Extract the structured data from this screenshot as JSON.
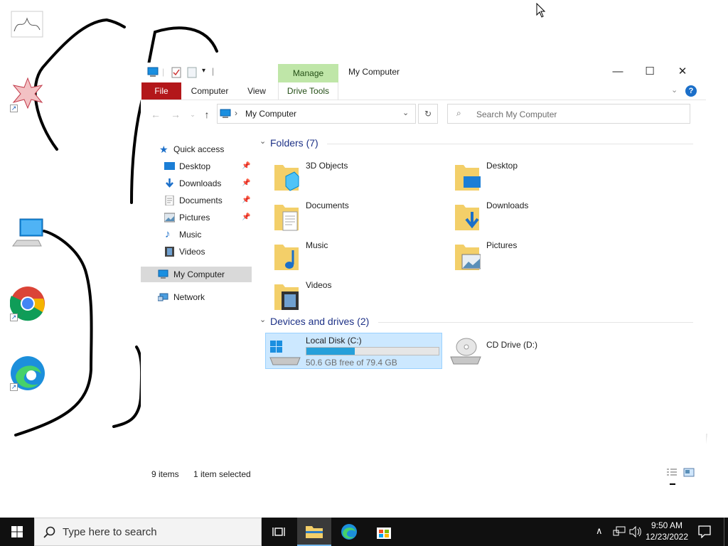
{
  "window": {
    "title": "My Computer",
    "manage_tab": "Manage",
    "drive_tools_tab": "Drive Tools",
    "tabs": [
      {
        "label": "File"
      },
      {
        "label": "Computer"
      },
      {
        "label": "View"
      }
    ],
    "controls": {
      "minimize": "—",
      "maximize": "☐",
      "close": "✕"
    },
    "help": "?"
  },
  "address": {
    "location": "My Computer"
  },
  "search": {
    "placeholder": "Search My Computer"
  },
  "nav_pane": {
    "quick_access": "Quick access",
    "items": [
      {
        "label": "Desktop",
        "pinned": true
      },
      {
        "label": "Downloads",
        "pinned": true
      },
      {
        "label": "Documents",
        "pinned": true
      },
      {
        "label": "Pictures",
        "pinned": true
      },
      {
        "label": "Music",
        "pinned": false
      },
      {
        "label": "Videos",
        "pinned": false
      }
    ],
    "this_pc": "My Computer",
    "network": "Network"
  },
  "content": {
    "folders_header": "Folders (7)",
    "folders": [
      {
        "label": "3D Objects"
      },
      {
        "label": "Desktop"
      },
      {
        "label": "Documents"
      },
      {
        "label": "Downloads"
      },
      {
        "label": "Music"
      },
      {
        "label": "Pictures"
      },
      {
        "label": "Videos"
      }
    ],
    "devices_header": "Devices and drives (2)",
    "drives": [
      {
        "label": "Local Disk (C:)",
        "free_text": "50.6 GB free of 79.4 GB",
        "used_fraction": 0.363,
        "selected": true
      },
      {
        "label": "CD Drive (D:)"
      }
    ]
  },
  "status": {
    "items": "9 items",
    "selected": "1 item selected"
  },
  "taskbar": {
    "search_placeholder": "Type here to search",
    "time": "9:50 AM",
    "date": "12/23/2022"
  },
  "colors": {
    "accent": "#26a0da",
    "file_tab": "#b3171a",
    "manage_tab": "#bfe6a8",
    "selection": "#cce8ff",
    "group_header": "#1e3287",
    "taskbar": "#101010"
  }
}
